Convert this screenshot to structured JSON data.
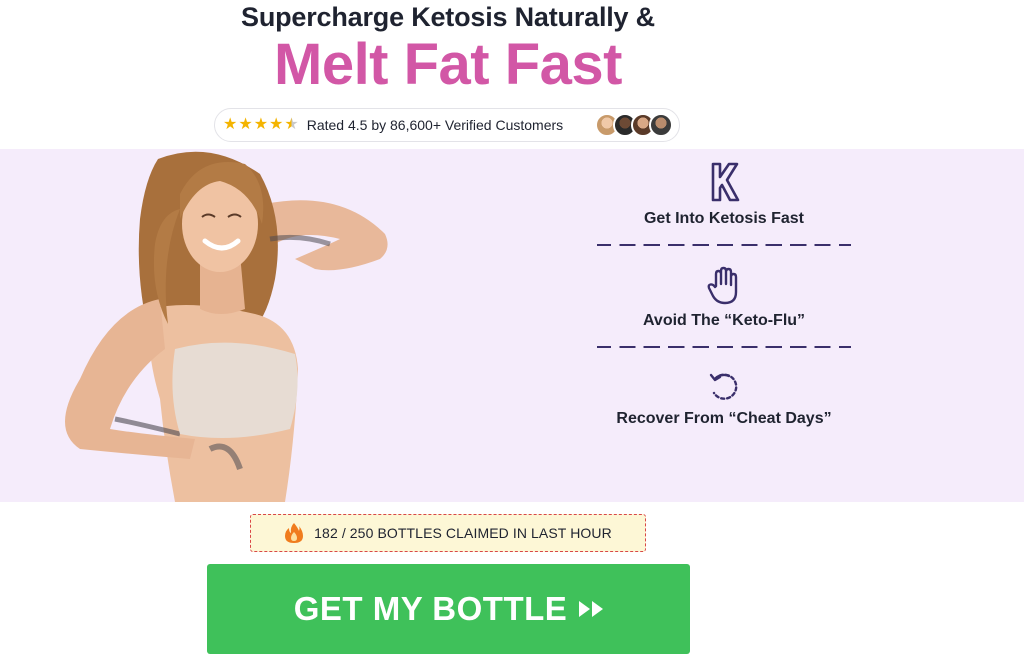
{
  "header": {
    "headline_small": "Supercharge Ketosis Naturally &",
    "headline_big": "Melt Fat Fast",
    "accent_color": "#d257a6"
  },
  "rating": {
    "stars": 4.5,
    "text": "Rated 4.5 by 86,600+ Verified Customers",
    "star_color": "#f4b400"
  },
  "hero": {
    "background": "#f5ecfb",
    "benefits": [
      {
        "icon": "keto-k-icon",
        "label": "Get Into Ketosis Fast"
      },
      {
        "icon": "hand-stop-icon",
        "label": "Avoid The “Keto-Flu”"
      },
      {
        "icon": "refresh-icon",
        "label": "Recover From “Cheat Days”"
      }
    ]
  },
  "claimed": {
    "icon": "fire-icon",
    "text": "182 / 250 BOTTLES CLAIMED IN LAST HOUR"
  },
  "cta": {
    "label": "GET MY BOTTLE",
    "icon": "double-arrow-icon",
    "color": "#3fc15a"
  }
}
